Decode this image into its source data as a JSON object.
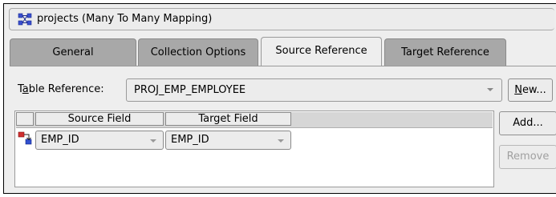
{
  "title": {
    "text": "projects (Many To Many Mapping)",
    "icon": "many-to-many-mapping-icon"
  },
  "tabs": [
    {
      "label": "General",
      "active": false
    },
    {
      "label": "Collection Options",
      "active": false
    },
    {
      "label": "Source Reference",
      "active": true
    },
    {
      "label": "Target Reference",
      "active": false
    }
  ],
  "table_reference": {
    "label_pre": "T",
    "label_mnemonic": "a",
    "label_post": "ble Reference:",
    "value": "PROJ_EMP_EMPLOYEE"
  },
  "buttons": {
    "new_pre": "",
    "new_mnemonic": "N",
    "new_post": "ew...",
    "add": "Add...",
    "remove": "Remove"
  },
  "field_table": {
    "columns": [
      "Source Field",
      "Target Field"
    ],
    "rows": [
      {
        "source": "EMP_ID",
        "target": "EMP_ID"
      }
    ]
  }
}
